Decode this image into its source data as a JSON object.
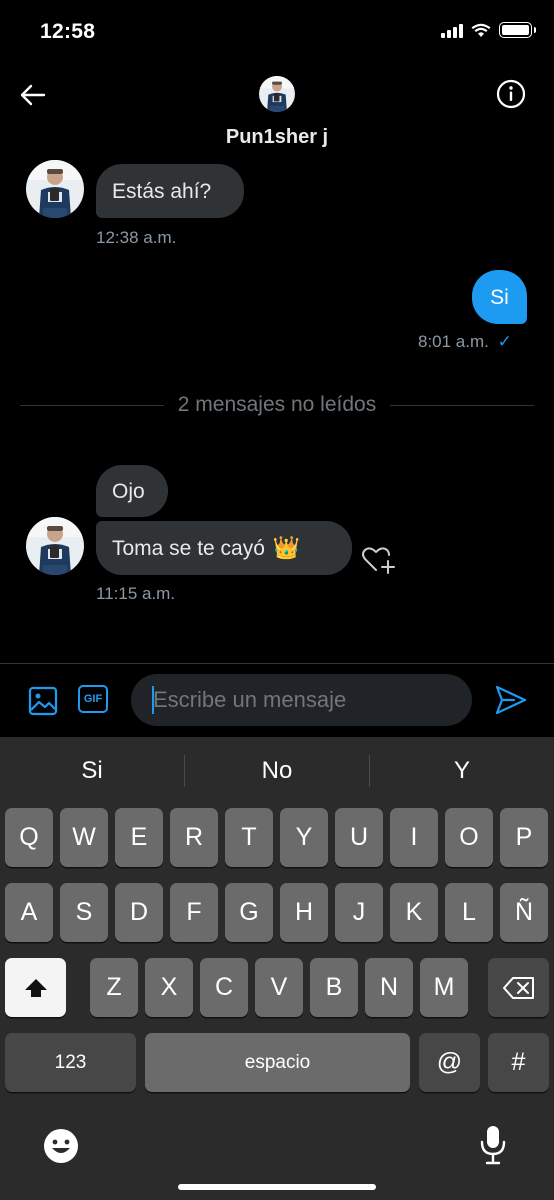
{
  "status_bar": {
    "time": "12:58"
  },
  "header": {
    "contact_name": "Pun1sher j"
  },
  "conversation": {
    "incoming_1": {
      "text": "Estás ahí?",
      "time": "12:38 a.m."
    },
    "outgoing_1": {
      "text": "Si",
      "time": "8:01 a.m.",
      "read_mark": "✓"
    },
    "unread_divider": "2 mensajes no leídos",
    "incoming_2": {
      "text": "Ojo"
    },
    "incoming_3": {
      "text": "Toma se te cayó",
      "emoji": "👑",
      "time": "11:15 a.m."
    }
  },
  "compose": {
    "placeholder": "Escribe un mensaje",
    "gif_label": "GIF"
  },
  "keyboard": {
    "suggestions": [
      "Si",
      "No",
      "Y"
    ],
    "row1": [
      "Q",
      "W",
      "E",
      "R",
      "T",
      "Y",
      "U",
      "I",
      "O",
      "P"
    ],
    "row2": [
      "A",
      "S",
      "D",
      "F",
      "G",
      "H",
      "J",
      "K",
      "L",
      "Ñ"
    ],
    "row3": [
      "Z",
      "X",
      "C",
      "V",
      "B",
      "N",
      "M"
    ],
    "numbers_label": "123",
    "space_label": "espacio",
    "at_label": "@",
    "hash_label": "#"
  },
  "colors": {
    "accent": "#1d9bf0",
    "bubble_incoming": "#2f3336",
    "background": "#000000"
  },
  "icons": [
    "back-arrow-icon",
    "info-icon",
    "image-icon",
    "gif-icon",
    "send-icon",
    "add-reaction-icon",
    "shift-icon",
    "backspace-icon",
    "emoji-icon",
    "microphone-icon",
    "wifi-icon",
    "battery-icon",
    "cell-signal-icon"
  ]
}
